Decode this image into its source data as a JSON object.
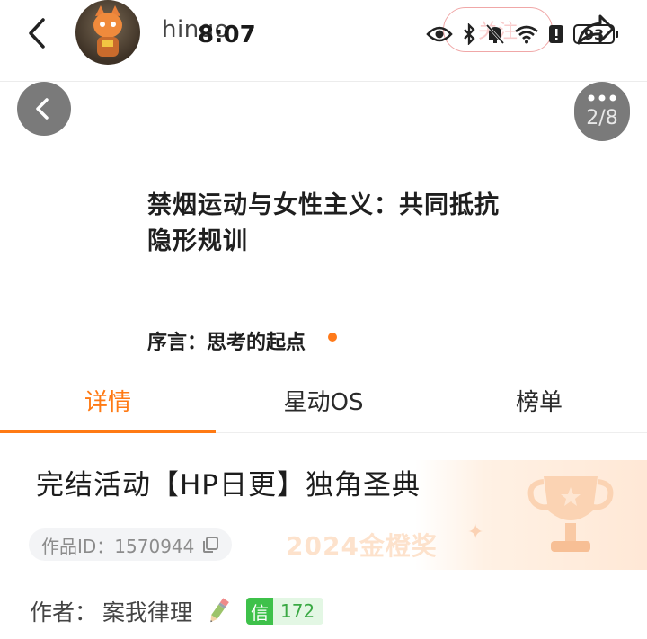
{
  "header": {
    "username": "hingo",
    "follow_label": "关注"
  },
  "status_bar": {
    "time": "8:07",
    "battery": "93"
  },
  "cover": {
    "page_indicator": "2/8",
    "title": "禁烟运动与女性主义：共同抵抗隐形规训",
    "subtitle": "序言：思考的起点"
  },
  "tabs": [
    {
      "label": "详情",
      "active": true
    },
    {
      "label": "星动OS",
      "active": false
    },
    {
      "label": "榜单",
      "active": false
    }
  ],
  "work": {
    "title": "完结活动【HP日更】独角圣典",
    "id_text": "作品ID：1570944",
    "award": "2024金橙奖"
  },
  "author": {
    "label": "作者：",
    "name": "案我律理",
    "credit_mark": "信",
    "credit_value": "172"
  },
  "colors": {
    "accent": "#ff7a14",
    "credit_green": "#3ec14a",
    "follow_red": "#ef6f6f"
  },
  "icons": [
    "back-chevron-icon",
    "eye-icon",
    "bluetooth-icon",
    "mute-bell-icon",
    "wifi-icon",
    "alert-icon",
    "battery-icon",
    "share-icon",
    "more-icon",
    "copy-icon",
    "pencil-icon",
    "trophy-icon"
  ]
}
